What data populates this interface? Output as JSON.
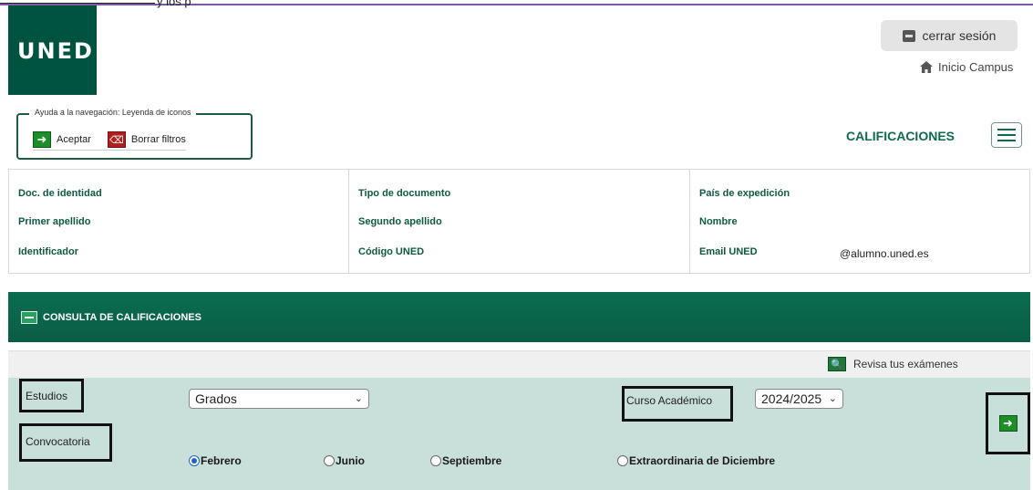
{
  "page": {
    "top_text": "y los p"
  },
  "brand": {
    "logo_text": "UNED"
  },
  "header": {
    "logout_label": "cerrar sesión",
    "home_label": "Inicio Campus",
    "section_title": "CALIFICACIONES"
  },
  "legend": {
    "title": "Ayuda a la navegación: Leyenda de iconos",
    "accept_label": "Aceptar",
    "clear_label": "Borrar filtros"
  },
  "student_info": {
    "doc_identidad": "Doc. de identidad",
    "tipo_documento": "Tipo de documento",
    "pais_expedicion": "País de expedición",
    "primer_apellido": "Primer apellido",
    "segundo_apellido": "Segundo apellido",
    "nombre": "Nombre",
    "identificador": "Identificador",
    "codigo_uned": "Código UNED",
    "email_uned": "Email UNED",
    "email_value": "@alumno.uned.es"
  },
  "consulta": {
    "title": "CONSULTA DE CALIFICACIONES",
    "review_label": "Revisa tus exámenes"
  },
  "filters": {
    "estudios_label": "Estudios",
    "estudios_value": "Grados",
    "curso_label": "Curso Académico",
    "curso_value": "2024/2025",
    "convocatoria_label": "Convocatoria",
    "options": [
      "Febrero",
      "Junio",
      "Septiembre",
      "Extraordinaria de Diciembre"
    ],
    "selected": "Febrero"
  }
}
